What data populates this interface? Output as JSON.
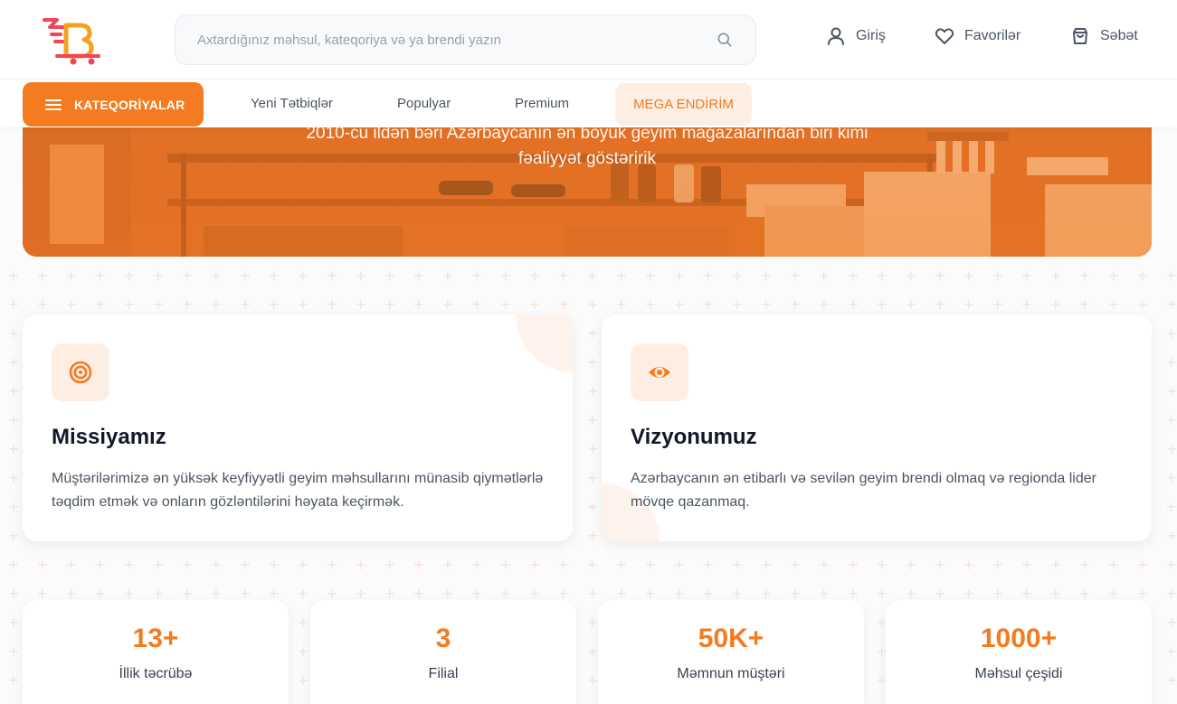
{
  "header": {
    "search_placeholder": "Axtardığınız məhsul, kateqoriya və ya brendi yazın",
    "login_label": "Giriş",
    "favorites_label": "Favorilər",
    "cart_label": "Səbət"
  },
  "nav": {
    "categories_label": "KATEQORİYALAR",
    "links": [
      "Yeni Tətbiqlər",
      "Populyar",
      "Premium"
    ],
    "mega_label": "MEGA ENDİRİM"
  },
  "hero": {
    "line1": "2010-cu ildən bəri Azərbaycanın ən böyük geyim mağazalarından biri kimi",
    "line2": "fəaliyyət göstəririk"
  },
  "cards": [
    {
      "icon": "target-icon",
      "title": "Missiyamız",
      "text": "Müştərilərimizə ən yüksək keyfiyyətli geyim məhsullarını münasib qiymətlərlə təqdim etmək və onların gözləntilərini həyata keçirmək."
    },
    {
      "icon": "eye-icon",
      "title": "Vizyonumuz",
      "text": "Azərbaycanın ən etibarlı və sevilən geyim brendi olmaq və regionda lider mövqe qazanmaq."
    }
  ],
  "stats": [
    {
      "value": "13+",
      "label": "İllik təcrübə"
    },
    {
      "value": "3",
      "label": "Filial"
    },
    {
      "value": "50K+",
      "label": "Məmnun müştəri"
    },
    {
      "value": "1000+",
      "label": "Məhsul çeşidi"
    }
  ],
  "colors": {
    "accent": "#f47b1f",
    "accent_light": "#fdeee4",
    "text_dark": "#111827",
    "text_muted": "#4b5563"
  }
}
